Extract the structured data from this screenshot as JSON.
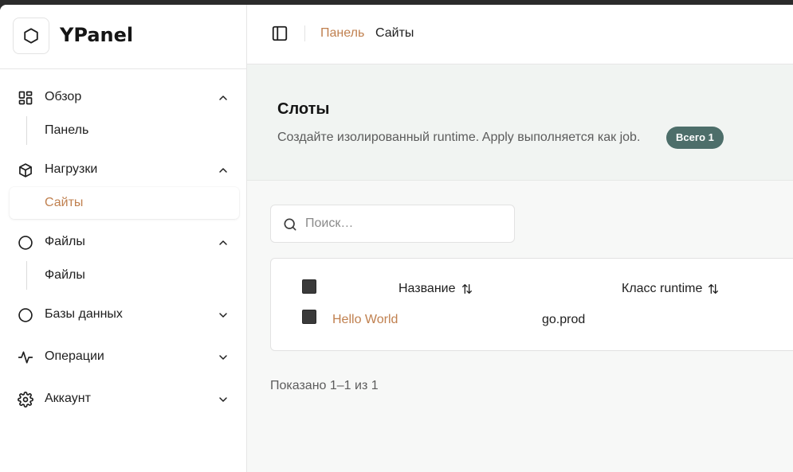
{
  "brand": {
    "name": "YPanel",
    "logo_icon": "hexagon-icon"
  },
  "sidebar": {
    "groups": [
      {
        "label": "Обзор",
        "icon": "dashboard-grid-icon",
        "expanded": true,
        "items": [
          {
            "label": "Панель"
          }
        ]
      },
      {
        "label": "Нагрузки",
        "icon": "cube-icon",
        "expanded": true,
        "items": [
          {
            "label": "Сайты",
            "active": true
          }
        ]
      },
      {
        "label": "Файлы",
        "icon": "circle-icon",
        "expanded": true,
        "items": [
          {
            "label": "Файлы"
          }
        ]
      },
      {
        "label": "Базы данных",
        "icon": "circle-icon",
        "expanded": false,
        "items": []
      },
      {
        "label": "Операции",
        "icon": "activity-pulse-icon",
        "expanded": false,
        "items": []
      },
      {
        "label": "Аккаунт",
        "icon": "gear-icon",
        "expanded": false,
        "items": []
      }
    ]
  },
  "breadcrumb": {
    "parent": "Панель",
    "current": "Сайты"
  },
  "hero": {
    "title": "Слоты",
    "description": "Создайте изолированный runtime. Apply выполняется как job.",
    "badge": "Всего 1"
  },
  "search": {
    "placeholder": "Поиск…",
    "value": ""
  },
  "table": {
    "columns": [
      {
        "label": "Название"
      },
      {
        "label": "Класс runtime"
      }
    ],
    "rows": [
      {
        "name": "Hello World",
        "runtime_class": "go.prod"
      }
    ]
  },
  "pagination": {
    "summary": "Показано 1–1 из 1"
  },
  "colors": {
    "accent": "#c0804f",
    "badge": "#4d6e6a"
  }
}
